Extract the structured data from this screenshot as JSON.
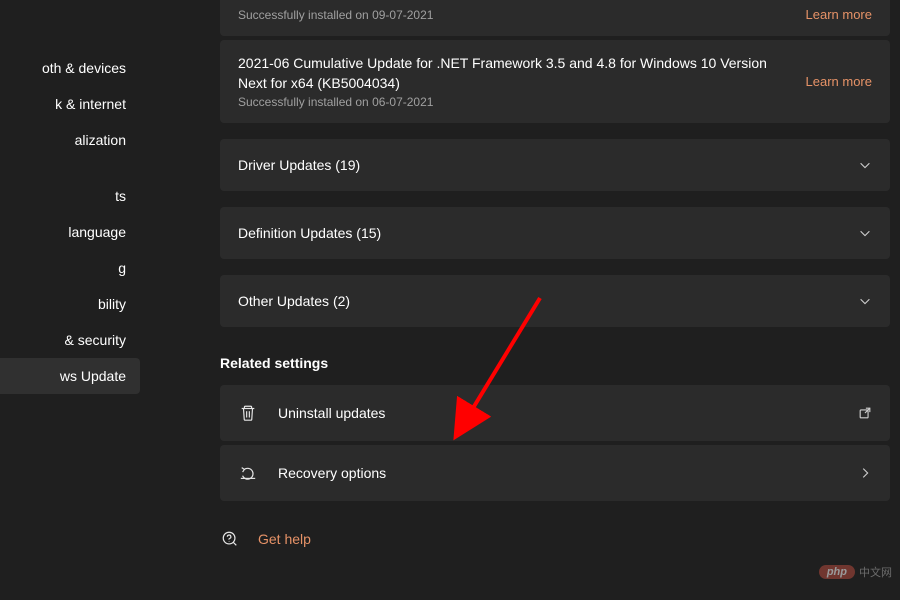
{
  "sidebar": {
    "items": [
      {
        "label": "oth & devices"
      },
      {
        "label": "k & internet"
      },
      {
        "label": "alization"
      },
      {
        "label": ""
      },
      {
        "label": "ts"
      },
      {
        "label": " language"
      },
      {
        "label": "g"
      },
      {
        "label": "bility"
      },
      {
        "label": " & security"
      },
      {
        "label": "ws Update",
        "selected": true
      }
    ]
  },
  "updates": {
    "item0_sub": "Successfully installed on 09-07-2021",
    "item0_learn": "Learn more",
    "item1_title": "2021-06 Cumulative Update for .NET Framework 3.5 and 4.8 for Windows 10 Version Next for x64 (KB5004034)",
    "item1_sub": "Successfully installed on 06-07-2021",
    "item1_learn": "Learn more"
  },
  "groups": {
    "driver": "Driver Updates (19)",
    "definition": "Definition Updates (15)",
    "other": "Other Updates (2)"
  },
  "related": {
    "heading": "Related settings",
    "uninstall": "Uninstall updates",
    "recovery": "Recovery options"
  },
  "help": {
    "label": "Get help"
  },
  "watermark": {
    "badge": "php",
    "text": "中文网"
  }
}
